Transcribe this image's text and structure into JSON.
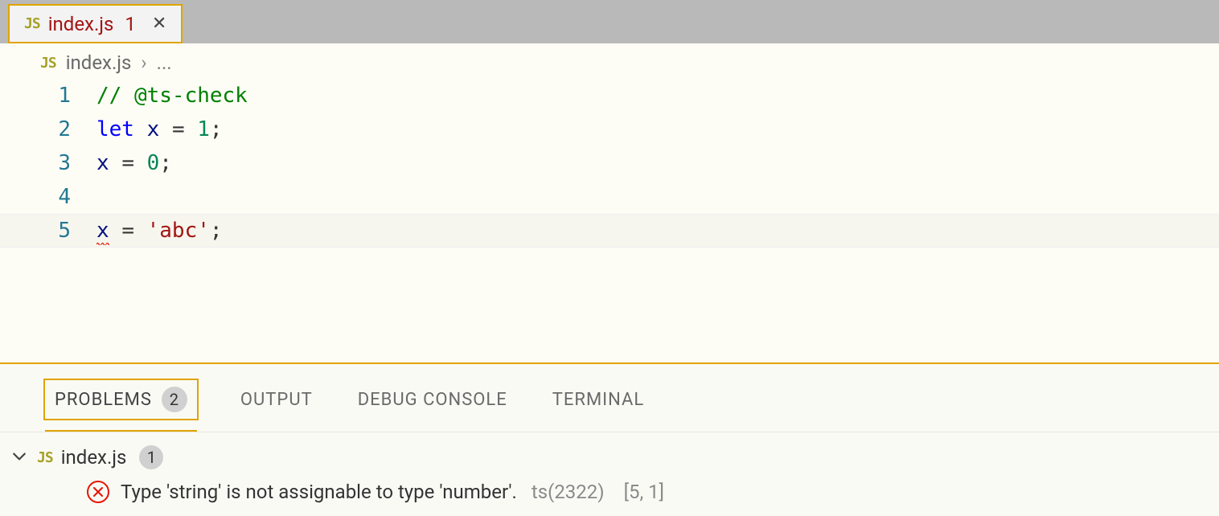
{
  "tab": {
    "icon_label": "JS",
    "filename": "index.js",
    "dirty_badge": "1",
    "close_glyph": "✕"
  },
  "breadcrumb": {
    "icon_label": "JS",
    "filename": "index.js",
    "chevron": "›",
    "rest": "..."
  },
  "code": {
    "lines": [
      {
        "num": "1",
        "tokens": [
          {
            "t": "// @ts-check",
            "cls": "tok-comment"
          }
        ]
      },
      {
        "num": "2",
        "tokens": [
          {
            "t": "let",
            "cls": "tok-keyword"
          },
          {
            "t": " ",
            "cls": ""
          },
          {
            "t": "x",
            "cls": "tok-ident"
          },
          {
            "t": " ",
            "cls": ""
          },
          {
            "t": "=",
            "cls": "tok-op"
          },
          {
            "t": " ",
            "cls": ""
          },
          {
            "t": "1",
            "cls": "tok-num"
          },
          {
            "t": ";",
            "cls": "tok-punc"
          }
        ]
      },
      {
        "num": "3",
        "tokens": [
          {
            "t": "x",
            "cls": "tok-ident"
          },
          {
            "t": " ",
            "cls": ""
          },
          {
            "t": "=",
            "cls": "tok-op"
          },
          {
            "t": " ",
            "cls": ""
          },
          {
            "t": "0",
            "cls": "tok-num"
          },
          {
            "t": ";",
            "cls": "tok-punc"
          }
        ]
      },
      {
        "num": "4",
        "tokens": []
      },
      {
        "num": "5",
        "current": true,
        "tokens": [
          {
            "t": "x",
            "cls": "tok-ident",
            "squiggle": true
          },
          {
            "t": " ",
            "cls": ""
          },
          {
            "t": "=",
            "cls": "tok-op"
          },
          {
            "t": " ",
            "cls": ""
          },
          {
            "t": "'abc'",
            "cls": "tok-str"
          },
          {
            "t": ";",
            "cls": "tok-punc"
          }
        ]
      }
    ]
  },
  "panel": {
    "tabs": {
      "problems": "PROBLEMS",
      "problems_count": "2",
      "output": "OUTPUT",
      "debug_console": "DEBUG CONSOLE",
      "terminal": "TERMINAL"
    },
    "file": {
      "chevron": "⌄",
      "icon_label": "JS",
      "name": "index.js",
      "count": "1"
    },
    "problem": {
      "message": "Type 'string' is not assignable to type 'number'.",
      "code_ref": "ts(2322)",
      "location": "[5, 1]"
    }
  }
}
